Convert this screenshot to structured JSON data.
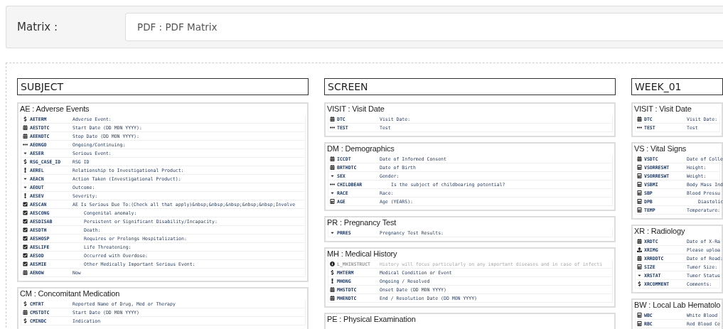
{
  "matrix": {
    "label": "Matrix :",
    "value": "PDF : PDF Matrix"
  },
  "columns": [
    {
      "title": "SUBJECT",
      "cards": [
        {
          "title": "AE : Adverse Events",
          "rows": [
            {
              "kind": "text",
              "code": "AETERM",
              "label": "Adverse Event:",
              "indented": false
            },
            {
              "kind": "date",
              "code": "AESTDTC",
              "label": "Start Date (DD MON YYYY):",
              "indented": false
            },
            {
              "kind": "date",
              "code": "AEENDTC",
              "label": "Stop Date (DD MON YYYY):",
              "indented": false
            },
            {
              "kind": "ellipsis",
              "code": "AEONGO",
              "label": "Ongoing/Continuing:",
              "indented": false
            },
            {
              "kind": "dropdown",
              "code": "AESER",
              "label": "Serious Event:",
              "indented": false
            },
            {
              "kind": "text",
              "code": "RSG_CASE_ID",
              "label": "RSG ID",
              "indented": false
            },
            {
              "kind": "radio",
              "code": "AEREL",
              "label": "Relationship to Investigational Product:",
              "indented": false
            },
            {
              "kind": "dropdown",
              "code": "AEACN",
              "label": "Action Taken (Investigational Product):",
              "indented": false
            },
            {
              "kind": "dropdown",
              "code": "AEOUT",
              "label": "Outcome:",
              "indented": false
            },
            {
              "kind": "radio",
              "code": "AESEV",
              "label": "Severity:",
              "indented": false
            },
            {
              "kind": "checkbox",
              "code": "AESCAN",
              "label": "AE Is Serious Due To:(Check all that apply)&nbsp;&nbsp;&nbsp;&nbsp;&nbsp;Involve",
              "indented": false
            },
            {
              "kind": "checkbox",
              "code": "AESCONG",
              "label": "Congenital anomaly:",
              "indented": true
            },
            {
              "kind": "checkbox",
              "code": "AESDISAB",
              "label": "Persistent or Significant Disability/Incapacity:",
              "indented": true
            },
            {
              "kind": "checkbox",
              "code": "AESDTH",
              "label": "Death:",
              "indented": true
            },
            {
              "kind": "checkbox",
              "code": "AESHOSP",
              "label": "Requires or Prolongs Hospitalization:",
              "indented": true
            },
            {
              "kind": "checkbox",
              "code": "AESLIFE",
              "label": "Life Threatening:",
              "indented": true
            },
            {
              "kind": "checkbox",
              "code": "AESOD",
              "label": "Occurred with Overdose:",
              "indented": true
            },
            {
              "kind": "checkbox",
              "code": "AESMIE",
              "label": "Other Medically Important Serious Event:",
              "indented": true
            },
            {
              "kind": "date",
              "code": "AENOW",
              "label": "Now",
              "indented": false
            }
          ]
        },
        {
          "title": "CM : Concomitant Medication",
          "rows": [
            {
              "kind": "text",
              "code": "CMTRT",
              "label": "Reported Name of Drug, Med or Therapy",
              "indented": false
            },
            {
              "kind": "date",
              "code": "CMSTDTC",
              "label": "Start Date (DD MON YYYY)",
              "indented": false
            },
            {
              "kind": "text",
              "code": "CMINDC",
              "label": "Indication",
              "indented": false
            }
          ]
        }
      ]
    },
    {
      "title": "SCREEN",
      "cards": [
        {
          "title": "VISIT : Visit Date",
          "rows": [
            {
              "kind": "date",
              "code": "DTC",
              "label": "Visit Date:",
              "indented": false
            },
            {
              "kind": "ellipsis",
              "code": "TEST",
              "label": "Test",
              "indented": false
            }
          ]
        },
        {
          "title": "DM : Demographics",
          "rows": [
            {
              "kind": "date",
              "code": "ICCDT",
              "label": "Date of Informed Consent",
              "indented": false
            },
            {
              "kind": "date",
              "code": "BRTHDTC",
              "label": "Date of Birth",
              "indented": false
            },
            {
              "kind": "dropdown",
              "code": "SEX",
              "label": "Gender:",
              "indented": false
            },
            {
              "kind": "ellipsis",
              "code": "CHILDBEAR",
              "label": "Is the subject of childbearing potential?",
              "indented": true
            },
            {
              "kind": "dropdown",
              "code": "RACE",
              "label": "Race:",
              "indented": false
            },
            {
              "kind": "number",
              "code": "AGE",
              "label": "Age (YEARS):",
              "indented": false
            }
          ]
        },
        {
          "title": "PR : Pregnancy Test",
          "rows": [
            {
              "kind": "dropdown",
              "code": "PRRES",
              "label": "Pregnancy Test Results:",
              "indented": false
            }
          ]
        },
        {
          "title": "MH : Medical History",
          "rows": [
            {
              "kind": "info",
              "code": "L_MHINSTRUCT",
              "label": "History will focus particularly on any important diseases and in case of infecti",
              "indented": false
            },
            {
              "kind": "text",
              "code": "MHTERM",
              "label": "Medical Condition or Event",
              "indented": false
            },
            {
              "kind": "radio",
              "code": "MHONG",
              "label": "Ongoing / Resolved",
              "indented": false
            },
            {
              "kind": "date",
              "code": "MHSTDTC",
              "label": "Onset Date (DD MON YYYY)",
              "indented": false
            },
            {
              "kind": "date",
              "code": "MHENDTC",
              "label": "End / Resolution Date (DD MON YYYY)",
              "indented": false
            }
          ]
        },
        {
          "title": "PE : Physical Examination"
        }
      ]
    },
    {
      "title": "WEEK_01",
      "cards": [
        {
          "title": "VISIT : Visit Date",
          "rows": [
            {
              "kind": "date",
              "code": "DTC",
              "label": "Visit Date:",
              "indented": false
            },
            {
              "kind": "ellipsis",
              "code": "TEST",
              "label": "Test",
              "indented": false
            }
          ]
        },
        {
          "title": "VS : Vital Signs",
          "rows": [
            {
              "kind": "date",
              "code": "VSDTC",
              "label": "Date of Colle",
              "indented": false
            },
            {
              "kind": "number",
              "code": "VSORRESHT",
              "label": "Height:",
              "indented": false
            },
            {
              "kind": "number",
              "code": "VSORRESWT",
              "label": "Weight:",
              "indented": false
            },
            {
              "kind": "number",
              "code": "VSBMI",
              "label": "Body Mass Ind",
              "indented": false
            },
            {
              "kind": "number",
              "code": "SBP",
              "label": "Blood Pressu",
              "indented": false
            },
            {
              "kind": "number",
              "code": "DPB",
              "label": "Diastolic",
              "indented": true
            },
            {
              "kind": "number",
              "code": "TEMP",
              "label": "Temperature:",
              "indented": false
            }
          ]
        },
        {
          "title": "XR : Radiology",
          "rows": [
            {
              "kind": "date",
              "code": "XRDTC",
              "label": "Date of X-Ra",
              "indented": false
            },
            {
              "kind": "upload",
              "code": "XRIMG",
              "label": "Please uploa",
              "indented": false
            },
            {
              "kind": "date",
              "code": "XRRDDTC",
              "label": "Date of Read:",
              "indented": false
            },
            {
              "kind": "number",
              "code": "SIZE",
              "label": "Tumor Size:",
              "indented": false
            },
            {
              "kind": "dropdown",
              "code": "XRSTAT",
              "label": "Tumor Status",
              "indented": false
            },
            {
              "kind": "text",
              "code": "XRCOMMENT",
              "label": "Comments:",
              "indented": false
            }
          ]
        },
        {
          "title": "BW : Local Lab Hematolo",
          "rows": [
            {
              "kind": "number",
              "code": "WBC",
              "label": "White Blood",
              "indented": false
            },
            {
              "kind": "number",
              "code": "RBC",
              "label": "Red Blood Ce",
              "indented": false
            }
          ]
        }
      ]
    }
  ]
}
